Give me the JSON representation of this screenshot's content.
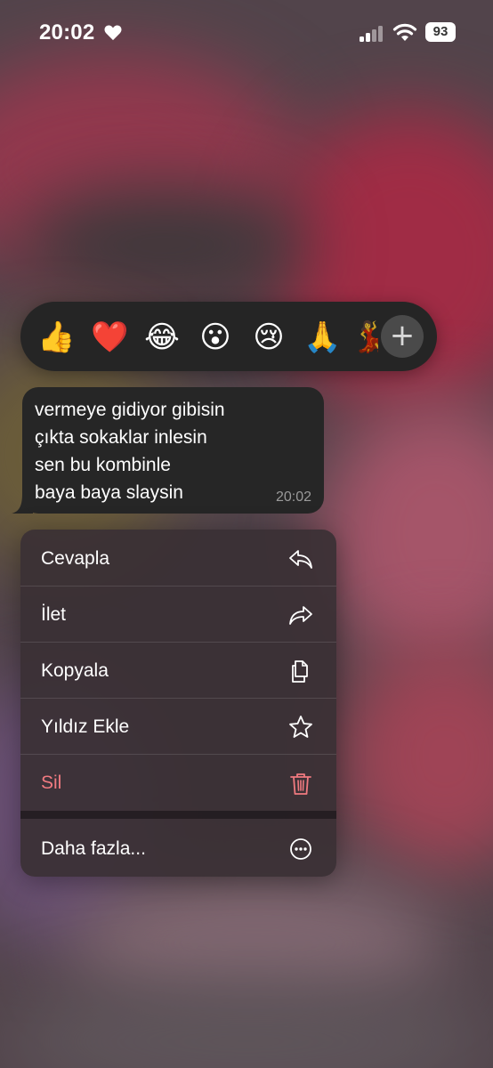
{
  "status_bar": {
    "time": "20:02",
    "battery": "93"
  },
  "reactions": {
    "emojis": [
      "👍",
      "❤️",
      "😂",
      "😮",
      "😢",
      "🙏",
      "💃"
    ],
    "more_symbol": "+"
  },
  "message": {
    "lines": [
      "vermeye gidiyor gibisin",
      "çıkta sokaklar inlesin",
      "sen bu kombinle",
      "baya baya slaysin"
    ],
    "time": "20:02"
  },
  "menu": {
    "items": [
      {
        "label": "Cevapla",
        "icon": "reply-icon"
      },
      {
        "label": "İlet",
        "icon": "forward-icon"
      },
      {
        "label": "Kopyala",
        "icon": "copy-icon"
      },
      {
        "label": "Yıldız Ekle",
        "icon": "star-icon"
      },
      {
        "label": "Sil",
        "icon": "trash-icon"
      },
      {
        "label": "Daha fazla...",
        "icon": "more-icon"
      }
    ],
    "delete_color": "#f07a80"
  }
}
